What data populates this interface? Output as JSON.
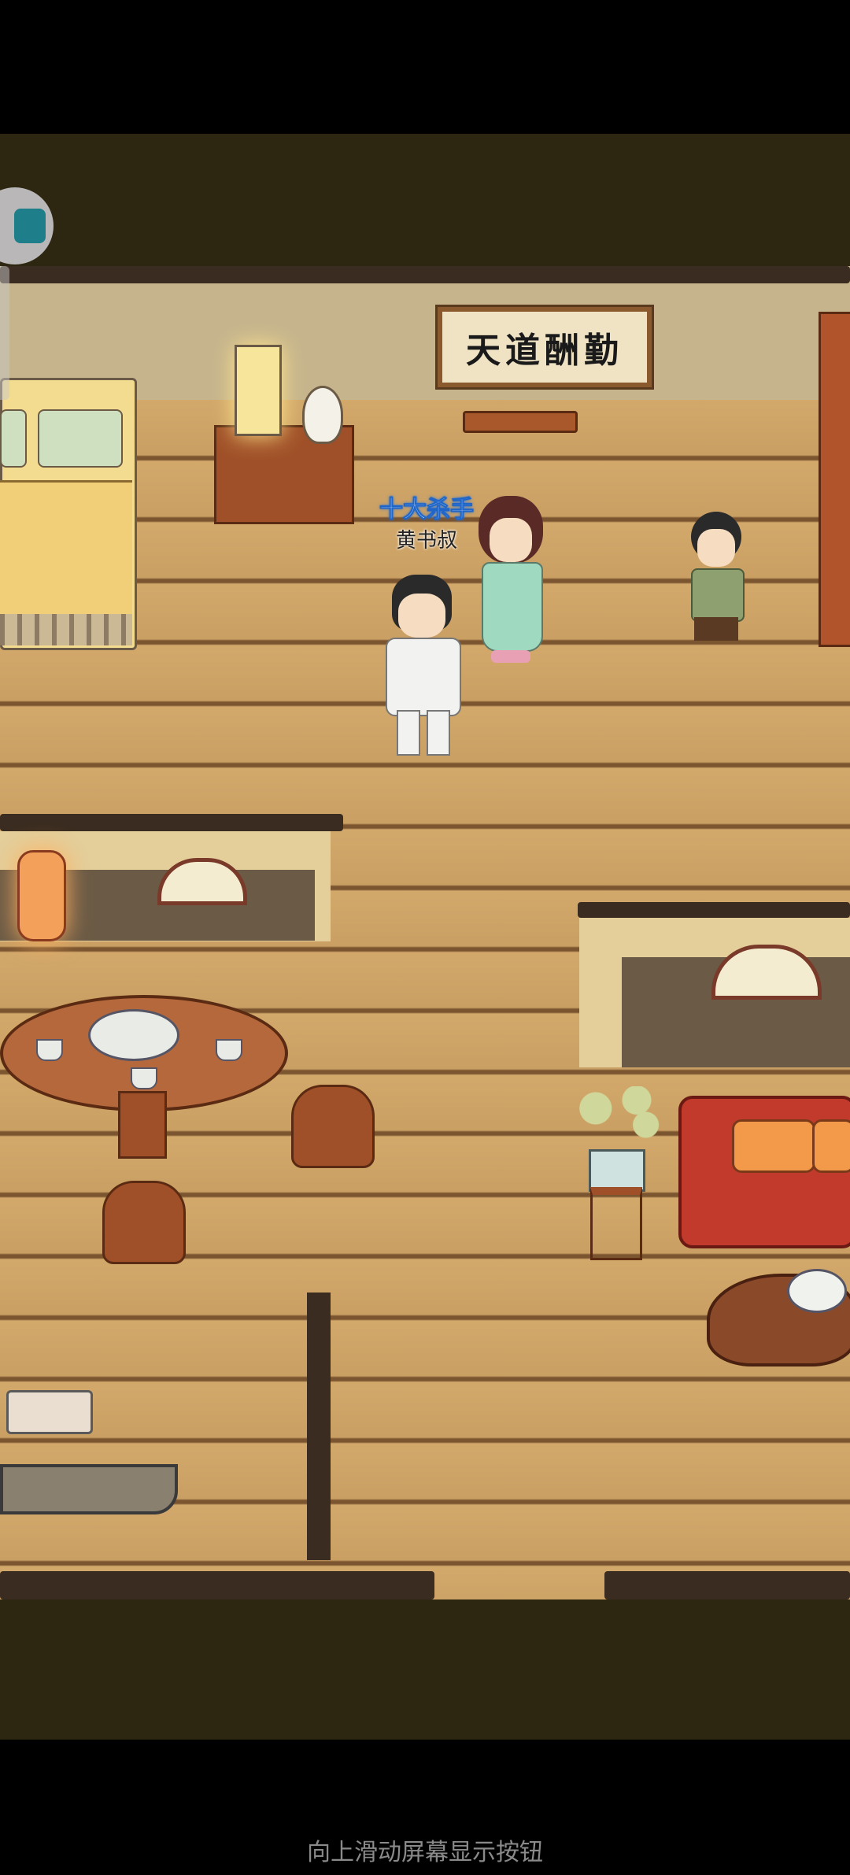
{
  "scene": {
    "wall_scroll_text": "天道酬勤",
    "player": {
      "title": "十大杀手",
      "name": "黄书叔"
    }
  },
  "overlay": {
    "swipe_hint": "向上滑动屏幕显示按钮"
  },
  "colors": {
    "floor": "#d2a86b",
    "beam": "#3a2c20",
    "title_glow": "#2a7ff0",
    "sofa": "#c23a2c"
  }
}
